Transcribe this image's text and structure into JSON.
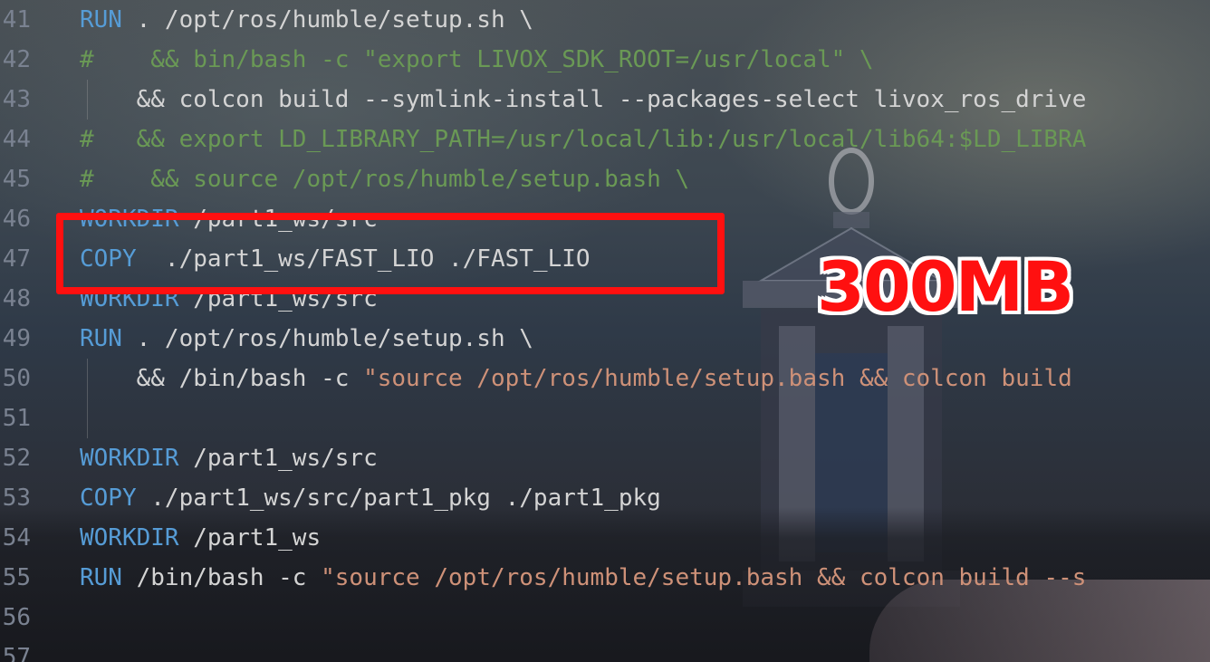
{
  "lines": [
    {
      "num": "41",
      "parts": [
        {
          "cls": "kw",
          "text": "RUN"
        },
        {
          "cls": "",
          "text": " . /opt/ros/humble/setup.sh \\"
        }
      ]
    },
    {
      "num": "42",
      "parts": [
        {
          "cls": "cm",
          "text": "#    && bin/bash -c \"export LIVOX_SDK_ROOT=/usr/local\" \\"
        }
      ]
    },
    {
      "num": "43",
      "parts": [
        {
          "cls": "",
          "text": "    && colcon build --symlink-install --packages-select livox_ros_drive"
        }
      ]
    },
    {
      "num": "44",
      "parts": [
        {
          "cls": "cm",
          "text": "#   && export LD_LIBRARY_PATH=/usr/local/lib:/usr/local/lib64:$LD_LIBRA"
        }
      ]
    },
    {
      "num": "45",
      "parts": [
        {
          "cls": "cm",
          "text": "#    && source /opt/ros/humble/setup.bash \\"
        }
      ]
    },
    {
      "num": "46",
      "parts": [
        {
          "cls": "kw",
          "text": "WORKDIR"
        },
        {
          "cls": "",
          "text": " /part1_ws/src"
        }
      ]
    },
    {
      "num": "47",
      "parts": [
        {
          "cls": "kw",
          "text": "COPY"
        },
        {
          "cls": "",
          "text": "  ./part1_ws/FAST_LIO ./FAST_LIO"
        }
      ]
    },
    {
      "num": "48",
      "parts": [
        {
          "cls": "kw",
          "text": "WORKDIR"
        },
        {
          "cls": "",
          "text": " /part1_ws/src"
        }
      ]
    },
    {
      "num": "49",
      "parts": [
        {
          "cls": "kw",
          "text": "RUN"
        },
        {
          "cls": "",
          "text": " . /opt/ros/humble/setup.sh \\"
        }
      ]
    },
    {
      "num": "50",
      "parts": [
        {
          "cls": "",
          "text": "    && /bin/bash -c "
        },
        {
          "cls": "str",
          "text": "\"source /opt/ros/humble/setup.bash && colcon build"
        }
      ]
    },
    {
      "num": "51",
      "parts": []
    },
    {
      "num": "52",
      "parts": [
        {
          "cls": "kw",
          "text": "WORKDIR"
        },
        {
          "cls": "",
          "text": " /part1_ws/src"
        }
      ]
    },
    {
      "num": "53",
      "parts": [
        {
          "cls": "kw",
          "text": "COPY"
        },
        {
          "cls": "",
          "text": " ./part1_ws/src/part1_pkg ./part1_pkg"
        }
      ]
    },
    {
      "num": "54",
      "parts": [
        {
          "cls": "kw",
          "text": "WORKDIR"
        },
        {
          "cls": "",
          "text": " /part1_ws"
        }
      ]
    },
    {
      "num": "55",
      "parts": [
        {
          "cls": "kw",
          "text": "RUN"
        },
        {
          "cls": "",
          "text": " /bin/bash -c "
        },
        {
          "cls": "str",
          "text": "\"source /opt/ros/humble/setup.bash && colcon build --s"
        }
      ]
    },
    {
      "num": "56",
      "parts": []
    },
    {
      "num": "57",
      "parts": []
    }
  ],
  "annotation": {
    "size_label": "300MB",
    "color": "#ff1010"
  },
  "colors": {
    "keyword": "#569cd6",
    "comment": "#6a9955",
    "string": "#ce9178",
    "text": "#d4d4d4",
    "line_number": "#7a8291"
  }
}
